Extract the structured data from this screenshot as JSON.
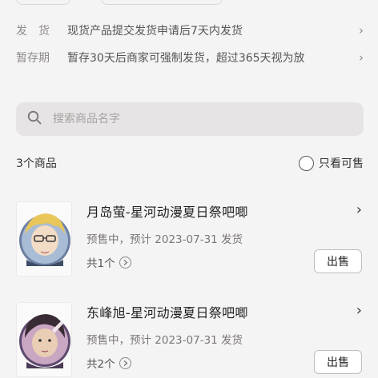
{
  "info_rows": [
    {
      "key": "发　货",
      "value": "现货产品提交发货申请后7天内发货"
    },
    {
      "key": "暂存期",
      "value": "暂存30天后商家可强制发货，超过365天视为放"
    }
  ],
  "search": {
    "placeholder": "搜索商品名字"
  },
  "list_header": {
    "count": "3个商品",
    "filter_label": "只看可售"
  },
  "products": [
    {
      "title": "月岛萤-星河动漫夏日祭吧唧",
      "status": "预售中，预计 2023-07-31 发货",
      "qty": "共1个",
      "sell": "出售"
    },
    {
      "title": "东峰旭-星河动漫夏日祭吧唧",
      "status": "预售中，预计 2023-07-31 发货",
      "qty": "共2个",
      "sell": "出售"
    }
  ],
  "colors": {
    "background": "#f5f4f4",
    "search_bg": "#e6e4e4",
    "muted": "#8e8a8a"
  }
}
